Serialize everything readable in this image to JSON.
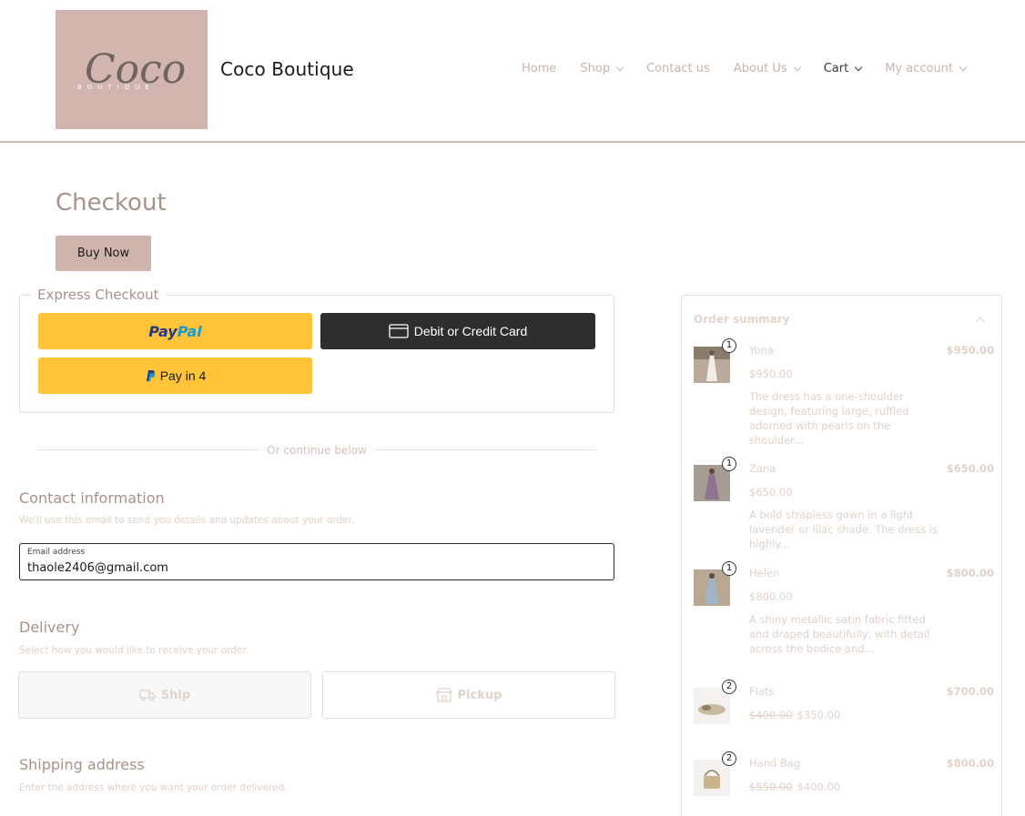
{
  "header": {
    "logo_script": "Coco",
    "logo_sub": "BOUTIQUE",
    "site_title": "Coco Boutique",
    "nav": [
      {
        "label": "Home"
      },
      {
        "label": "Shop"
      },
      {
        "label": "Contact us"
      },
      {
        "label": "About Us"
      },
      {
        "label": "Cart"
      },
      {
        "label": "My account"
      }
    ]
  },
  "page": {
    "title": "Checkout",
    "buy_now": "Buy Now"
  },
  "express": {
    "legend": "Express Checkout",
    "paypal_pay": "Pay",
    "paypal_pal": "Pal",
    "card_label": "Debit or Credit Card",
    "pay_in_4": "Pay in 4",
    "or_continue": "Or continue below"
  },
  "contact": {
    "title": "Contact information",
    "desc": "We'll use this email to send you details and updates about your order.",
    "email_label": "Email address",
    "email_value": "thaole2406@gmail.com"
  },
  "delivery": {
    "title": "Delivery",
    "desc": "Select how you would like to receive your order.",
    "ship": "Ship",
    "pickup": "Pickup"
  },
  "shipping": {
    "title": "Shipping address",
    "desc": "Enter the address where you want your order delivered."
  },
  "summary": {
    "title": "Order summary",
    "items": [
      {
        "name": "Yona",
        "qty": "1",
        "total": "$950.00",
        "price": "$950.00",
        "old_price": "",
        "desc": "The dress has a one-shoulder design, featuring large, ruffled adorned with pearls on the shoulder..."
      },
      {
        "name": "Zana",
        "qty": "1",
        "total": "$650.00",
        "price": "$650.00",
        "old_price": "",
        "desc": "A bold strapless gown in a light lavender or lilac shade. The dress is highly..."
      },
      {
        "name": "Helen",
        "qty": "1",
        "total": "$800.00",
        "price": "$800.00",
        "old_price": "",
        "desc": "A shiny metallic satin fabric fitted and draped beautifully, with detail across the bodice and..."
      },
      {
        "name": "Flats",
        "qty": "2",
        "total": "$700.00",
        "price": "$350.00",
        "old_price": "$400.00",
        "desc": ""
      },
      {
        "name": "Hand Bag",
        "qty": "2",
        "total": "$800.00",
        "price": "$400.00",
        "old_price": "$550.00",
        "desc": ""
      }
    ]
  }
}
